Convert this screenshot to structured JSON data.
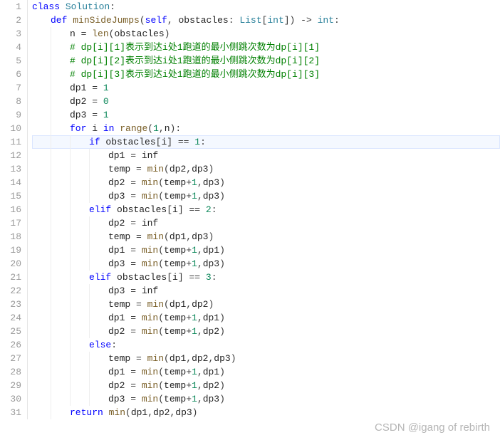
{
  "watermark": "CSDN @igang of rebirth",
  "highlight_line": 11,
  "lines": [
    {
      "n": 1,
      "indent": 0,
      "tokens": [
        {
          "t": "class ",
          "c": "kw"
        },
        {
          "t": "Solution",
          "c": "cls"
        },
        {
          "t": ":",
          "c": "pun"
        }
      ]
    },
    {
      "n": 2,
      "indent": 1,
      "tokens": [
        {
          "t": "def ",
          "c": "kw"
        },
        {
          "t": "minSideJumps",
          "c": "fn"
        },
        {
          "t": "(",
          "c": "pun"
        },
        {
          "t": "self",
          "c": "slf"
        },
        {
          "t": ", ",
          "c": "pun"
        },
        {
          "t": "obstacles",
          "c": "id"
        },
        {
          "t": ": ",
          "c": "pun"
        },
        {
          "t": "List",
          "c": "typ"
        },
        {
          "t": "[",
          "c": "pun"
        },
        {
          "t": "int",
          "c": "typ"
        },
        {
          "t": "]) -> ",
          "c": "pun"
        },
        {
          "t": "int",
          "c": "typ"
        },
        {
          "t": ":",
          "c": "pun"
        }
      ]
    },
    {
      "n": 3,
      "indent": 2,
      "tokens": [
        {
          "t": "n",
          "c": "id"
        },
        {
          "t": " = ",
          "c": "op"
        },
        {
          "t": "len",
          "c": "fn"
        },
        {
          "t": "(",
          "c": "pun"
        },
        {
          "t": "obstacles",
          "c": "id"
        },
        {
          "t": ")",
          "c": "pun"
        }
      ]
    },
    {
      "n": 4,
      "indent": 2,
      "tokens": [
        {
          "t": "# dp[i][1]表示到达i处1跑道的最小侧跳次数为dp[i][1]",
          "c": "cmt"
        }
      ]
    },
    {
      "n": 5,
      "indent": 2,
      "tokens": [
        {
          "t": "# dp[i][2]表示到达i处1跑道的最小侧跳次数为dp[i][2]",
          "c": "cmt"
        }
      ]
    },
    {
      "n": 6,
      "indent": 2,
      "tokens": [
        {
          "t": "# dp[i][3]表示到达i处1跑道的最小侧跳次数为dp[i][3]",
          "c": "cmt"
        }
      ]
    },
    {
      "n": 7,
      "indent": 2,
      "tokens": [
        {
          "t": "dp1",
          "c": "id"
        },
        {
          "t": " = ",
          "c": "op"
        },
        {
          "t": "1",
          "c": "num"
        }
      ]
    },
    {
      "n": 8,
      "indent": 2,
      "tokens": [
        {
          "t": "dp2",
          "c": "id"
        },
        {
          "t": " = ",
          "c": "op"
        },
        {
          "t": "0",
          "c": "num"
        }
      ]
    },
    {
      "n": 9,
      "indent": 2,
      "tokens": [
        {
          "t": "dp3",
          "c": "id"
        },
        {
          "t": " = ",
          "c": "op"
        },
        {
          "t": "1",
          "c": "num"
        }
      ]
    },
    {
      "n": 10,
      "indent": 2,
      "tokens": [
        {
          "t": "for ",
          "c": "kw"
        },
        {
          "t": "i",
          "c": "id"
        },
        {
          "t": " in ",
          "c": "kw"
        },
        {
          "t": "range",
          "c": "fn"
        },
        {
          "t": "(",
          "c": "pun"
        },
        {
          "t": "1",
          "c": "num"
        },
        {
          "t": ",",
          "c": "pun"
        },
        {
          "t": "n",
          "c": "id"
        },
        {
          "t": "):",
          "c": "pun"
        }
      ]
    },
    {
      "n": 11,
      "indent": 3,
      "tokens": [
        {
          "t": "if ",
          "c": "kw"
        },
        {
          "t": "obstacles",
          "c": "id"
        },
        {
          "t": "[",
          "c": "pun"
        },
        {
          "t": "i",
          "c": "id"
        },
        {
          "t": "] == ",
          "c": "op"
        },
        {
          "t": "1",
          "c": "num"
        },
        {
          "t": ":",
          "c": "pun"
        }
      ]
    },
    {
      "n": 12,
      "indent": 4,
      "tokens": [
        {
          "t": "dp1",
          "c": "id"
        },
        {
          "t": " = ",
          "c": "op"
        },
        {
          "t": "inf",
          "c": "id"
        }
      ]
    },
    {
      "n": 13,
      "indent": 4,
      "tokens": [
        {
          "t": "temp",
          "c": "id"
        },
        {
          "t": " = ",
          "c": "op"
        },
        {
          "t": "min",
          "c": "fn"
        },
        {
          "t": "(",
          "c": "pun"
        },
        {
          "t": "dp2",
          "c": "id"
        },
        {
          "t": ",",
          "c": "pun"
        },
        {
          "t": "dp3",
          "c": "id"
        },
        {
          "t": ")",
          "c": "pun"
        }
      ]
    },
    {
      "n": 14,
      "indent": 4,
      "tokens": [
        {
          "t": "dp2",
          "c": "id"
        },
        {
          "t": " = ",
          "c": "op"
        },
        {
          "t": "min",
          "c": "fn"
        },
        {
          "t": "(",
          "c": "pun"
        },
        {
          "t": "temp",
          "c": "id"
        },
        {
          "t": "+",
          "c": "op"
        },
        {
          "t": "1",
          "c": "num"
        },
        {
          "t": ",",
          "c": "pun"
        },
        {
          "t": "dp3",
          "c": "id"
        },
        {
          "t": ")",
          "c": "pun"
        }
      ]
    },
    {
      "n": 15,
      "indent": 4,
      "tokens": [
        {
          "t": "dp3",
          "c": "id"
        },
        {
          "t": " = ",
          "c": "op"
        },
        {
          "t": "min",
          "c": "fn"
        },
        {
          "t": "(",
          "c": "pun"
        },
        {
          "t": "temp",
          "c": "id"
        },
        {
          "t": "+",
          "c": "op"
        },
        {
          "t": "1",
          "c": "num"
        },
        {
          "t": ",",
          "c": "pun"
        },
        {
          "t": "dp3",
          "c": "id"
        },
        {
          "t": ")",
          "c": "pun"
        }
      ]
    },
    {
      "n": 16,
      "indent": 3,
      "tokens": [
        {
          "t": "elif ",
          "c": "kw"
        },
        {
          "t": "obstacles",
          "c": "id"
        },
        {
          "t": "[",
          "c": "pun"
        },
        {
          "t": "i",
          "c": "id"
        },
        {
          "t": "] == ",
          "c": "op"
        },
        {
          "t": "2",
          "c": "num"
        },
        {
          "t": ":",
          "c": "pun"
        }
      ]
    },
    {
      "n": 17,
      "indent": 4,
      "tokens": [
        {
          "t": "dp2",
          "c": "id"
        },
        {
          "t": " = ",
          "c": "op"
        },
        {
          "t": "inf",
          "c": "id"
        }
      ]
    },
    {
      "n": 18,
      "indent": 4,
      "tokens": [
        {
          "t": "temp",
          "c": "id"
        },
        {
          "t": " = ",
          "c": "op"
        },
        {
          "t": "min",
          "c": "fn"
        },
        {
          "t": "(",
          "c": "pun"
        },
        {
          "t": "dp1",
          "c": "id"
        },
        {
          "t": ",",
          "c": "pun"
        },
        {
          "t": "dp3",
          "c": "id"
        },
        {
          "t": ")",
          "c": "pun"
        }
      ]
    },
    {
      "n": 19,
      "indent": 4,
      "tokens": [
        {
          "t": "dp1",
          "c": "id"
        },
        {
          "t": " = ",
          "c": "op"
        },
        {
          "t": "min",
          "c": "fn"
        },
        {
          "t": "(",
          "c": "pun"
        },
        {
          "t": "temp",
          "c": "id"
        },
        {
          "t": "+",
          "c": "op"
        },
        {
          "t": "1",
          "c": "num"
        },
        {
          "t": ",",
          "c": "pun"
        },
        {
          "t": "dp1",
          "c": "id"
        },
        {
          "t": ")",
          "c": "pun"
        }
      ]
    },
    {
      "n": 20,
      "indent": 4,
      "tokens": [
        {
          "t": "dp3",
          "c": "id"
        },
        {
          "t": " = ",
          "c": "op"
        },
        {
          "t": "min",
          "c": "fn"
        },
        {
          "t": "(",
          "c": "pun"
        },
        {
          "t": "temp",
          "c": "id"
        },
        {
          "t": "+",
          "c": "op"
        },
        {
          "t": "1",
          "c": "num"
        },
        {
          "t": ",",
          "c": "pun"
        },
        {
          "t": "dp3",
          "c": "id"
        },
        {
          "t": ")",
          "c": "pun"
        }
      ]
    },
    {
      "n": 21,
      "indent": 3,
      "tokens": [
        {
          "t": "elif ",
          "c": "kw"
        },
        {
          "t": "obstacles",
          "c": "id"
        },
        {
          "t": "[",
          "c": "pun"
        },
        {
          "t": "i",
          "c": "id"
        },
        {
          "t": "] == ",
          "c": "op"
        },
        {
          "t": "3",
          "c": "num"
        },
        {
          "t": ":",
          "c": "pun"
        }
      ]
    },
    {
      "n": 22,
      "indent": 4,
      "tokens": [
        {
          "t": "dp3",
          "c": "id"
        },
        {
          "t": " = ",
          "c": "op"
        },
        {
          "t": "inf",
          "c": "id"
        }
      ]
    },
    {
      "n": 23,
      "indent": 4,
      "tokens": [
        {
          "t": "temp",
          "c": "id"
        },
        {
          "t": " = ",
          "c": "op"
        },
        {
          "t": "min",
          "c": "fn"
        },
        {
          "t": "(",
          "c": "pun"
        },
        {
          "t": "dp1",
          "c": "id"
        },
        {
          "t": ",",
          "c": "pun"
        },
        {
          "t": "dp2",
          "c": "id"
        },
        {
          "t": ")",
          "c": "pun"
        }
      ]
    },
    {
      "n": 24,
      "indent": 4,
      "tokens": [
        {
          "t": "dp1",
          "c": "id"
        },
        {
          "t": " = ",
          "c": "op"
        },
        {
          "t": "min",
          "c": "fn"
        },
        {
          "t": "(",
          "c": "pun"
        },
        {
          "t": "temp",
          "c": "id"
        },
        {
          "t": "+",
          "c": "op"
        },
        {
          "t": "1",
          "c": "num"
        },
        {
          "t": ",",
          "c": "pun"
        },
        {
          "t": "dp1",
          "c": "id"
        },
        {
          "t": ")",
          "c": "pun"
        }
      ]
    },
    {
      "n": 25,
      "indent": 4,
      "tokens": [
        {
          "t": "dp2",
          "c": "id"
        },
        {
          "t": " = ",
          "c": "op"
        },
        {
          "t": "min",
          "c": "fn"
        },
        {
          "t": "(",
          "c": "pun"
        },
        {
          "t": "temp",
          "c": "id"
        },
        {
          "t": "+",
          "c": "op"
        },
        {
          "t": "1",
          "c": "num"
        },
        {
          "t": ",",
          "c": "pun"
        },
        {
          "t": "dp2",
          "c": "id"
        },
        {
          "t": ")",
          "c": "pun"
        }
      ]
    },
    {
      "n": 26,
      "indent": 3,
      "tokens": [
        {
          "t": "else",
          "c": "kw"
        },
        {
          "t": ":",
          "c": "pun"
        }
      ]
    },
    {
      "n": 27,
      "indent": 4,
      "tokens": [
        {
          "t": "temp",
          "c": "id"
        },
        {
          "t": " = ",
          "c": "op"
        },
        {
          "t": "min",
          "c": "fn"
        },
        {
          "t": "(",
          "c": "pun"
        },
        {
          "t": "dp1",
          "c": "id"
        },
        {
          "t": ",",
          "c": "pun"
        },
        {
          "t": "dp2",
          "c": "id"
        },
        {
          "t": ",",
          "c": "pun"
        },
        {
          "t": "dp3",
          "c": "id"
        },
        {
          "t": ")",
          "c": "pun"
        }
      ]
    },
    {
      "n": 28,
      "indent": 4,
      "tokens": [
        {
          "t": "dp1",
          "c": "id"
        },
        {
          "t": " = ",
          "c": "op"
        },
        {
          "t": "min",
          "c": "fn"
        },
        {
          "t": "(",
          "c": "pun"
        },
        {
          "t": "temp",
          "c": "id"
        },
        {
          "t": "+",
          "c": "op"
        },
        {
          "t": "1",
          "c": "num"
        },
        {
          "t": ",",
          "c": "pun"
        },
        {
          "t": "dp1",
          "c": "id"
        },
        {
          "t": ")",
          "c": "pun"
        }
      ]
    },
    {
      "n": 29,
      "indent": 4,
      "tokens": [
        {
          "t": "dp2",
          "c": "id"
        },
        {
          "t": " = ",
          "c": "op"
        },
        {
          "t": "min",
          "c": "fn"
        },
        {
          "t": "(",
          "c": "pun"
        },
        {
          "t": "temp",
          "c": "id"
        },
        {
          "t": "+",
          "c": "op"
        },
        {
          "t": "1",
          "c": "num"
        },
        {
          "t": ",",
          "c": "pun"
        },
        {
          "t": "dp2",
          "c": "id"
        },
        {
          "t": ")",
          "c": "pun"
        }
      ]
    },
    {
      "n": 30,
      "indent": 4,
      "tokens": [
        {
          "t": "dp3",
          "c": "id"
        },
        {
          "t": " = ",
          "c": "op"
        },
        {
          "t": "min",
          "c": "fn"
        },
        {
          "t": "(",
          "c": "pun"
        },
        {
          "t": "temp",
          "c": "id"
        },
        {
          "t": "+",
          "c": "op"
        },
        {
          "t": "1",
          "c": "num"
        },
        {
          "t": ",",
          "c": "pun"
        },
        {
          "t": "dp3",
          "c": "id"
        },
        {
          "t": ")",
          "c": "pun"
        }
      ]
    },
    {
      "n": 31,
      "indent": 2,
      "tokens": [
        {
          "t": "return ",
          "c": "kw"
        },
        {
          "t": "min",
          "c": "fn"
        },
        {
          "t": "(",
          "c": "pun"
        },
        {
          "t": "dp1",
          "c": "id"
        },
        {
          "t": ",",
          "c": "pun"
        },
        {
          "t": "dp2",
          "c": "id"
        },
        {
          "t": ",",
          "c": "pun"
        },
        {
          "t": "dp3",
          "c": "id"
        },
        {
          "t": ")",
          "c": "pun"
        }
      ]
    }
  ]
}
